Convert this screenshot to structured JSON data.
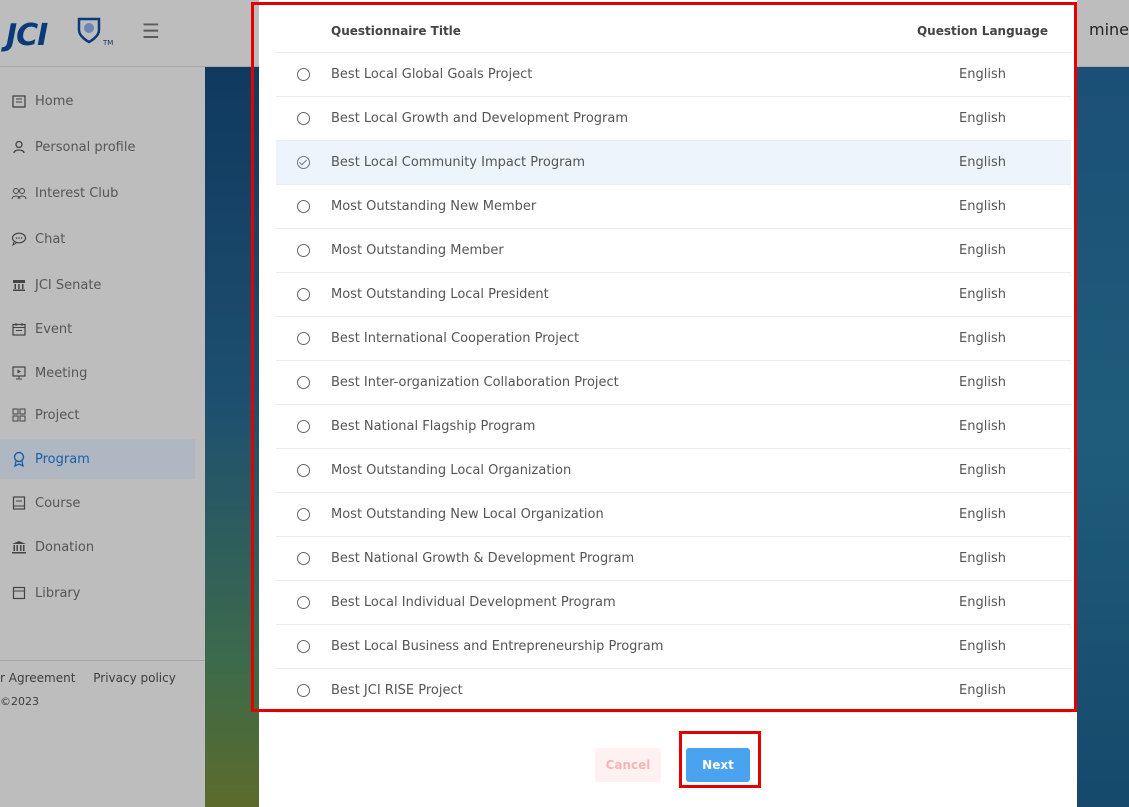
{
  "header": {
    "logo_text": "JCI",
    "logo_tm": "TM",
    "menu_icon": "hamburger-icon",
    "right_text": "mine"
  },
  "sidebar": {
    "items": [
      {
        "label": "Home",
        "icon": "home-icon"
      },
      {
        "label": "Personal profile",
        "icon": "user-icon"
      },
      {
        "label": "Interest Club",
        "icon": "group-icon"
      },
      {
        "label": "Chat",
        "icon": "chat-icon"
      },
      {
        "label": "JCI Senate",
        "icon": "senate-icon"
      },
      {
        "label": "Event",
        "icon": "calendar-icon"
      },
      {
        "label": "Meeting",
        "icon": "presentation-icon"
      },
      {
        "label": "Project",
        "icon": "grid-icon"
      },
      {
        "label": "Program",
        "icon": "award-icon",
        "active": true
      },
      {
        "label": "Course",
        "icon": "book-icon"
      },
      {
        "label": "Donation",
        "icon": "bank-icon"
      },
      {
        "label": "Library",
        "icon": "library-icon"
      }
    ],
    "footer_link_1": "r Agreement",
    "footer_link_2": "Privacy policy",
    "copyright": "©2023"
  },
  "table": {
    "header_title": "Questionnaire Title",
    "header_lang": "Question Language",
    "rows": [
      {
        "title": "Best Local Global Goals Project",
        "lang": "English",
        "selected": false
      },
      {
        "title": "Best Local Growth and Development Program",
        "lang": "English",
        "selected": false
      },
      {
        "title": "Best Local Community Impact Program",
        "lang": "English",
        "selected": true
      },
      {
        "title": "Most Outstanding New Member",
        "lang": "English",
        "selected": false
      },
      {
        "title": "Most Outstanding Member",
        "lang": "English",
        "selected": false
      },
      {
        "title": "Most Outstanding Local President",
        "lang": "English",
        "selected": false
      },
      {
        "title": "Best International Cooperation Project",
        "lang": "English",
        "selected": false
      },
      {
        "title": "Best Inter-organization Collaboration Project",
        "lang": "English",
        "selected": false
      },
      {
        "title": "Best National Flagship Program",
        "lang": "English",
        "selected": false
      },
      {
        "title": "Most Outstanding Local Organization",
        "lang": "English",
        "selected": false
      },
      {
        "title": "Most Outstanding New Local Organization",
        "lang": "English",
        "selected": false
      },
      {
        "title": "Best National Growth & Development Program",
        "lang": "English",
        "selected": false
      },
      {
        "title": "Best Local Individual Development Program",
        "lang": "English",
        "selected": false
      },
      {
        "title": "Best Local Business and Entrepreneurship Program",
        "lang": "English",
        "selected": false
      },
      {
        "title": "Best JCI RISE Project",
        "lang": "English",
        "selected": false
      }
    ]
  },
  "buttons": {
    "cancel": "Cancel",
    "next": "Next"
  },
  "colors": {
    "accent": "#4aa3ef",
    "highlight": "#e30000",
    "active_nav": "#1b5fa8"
  }
}
